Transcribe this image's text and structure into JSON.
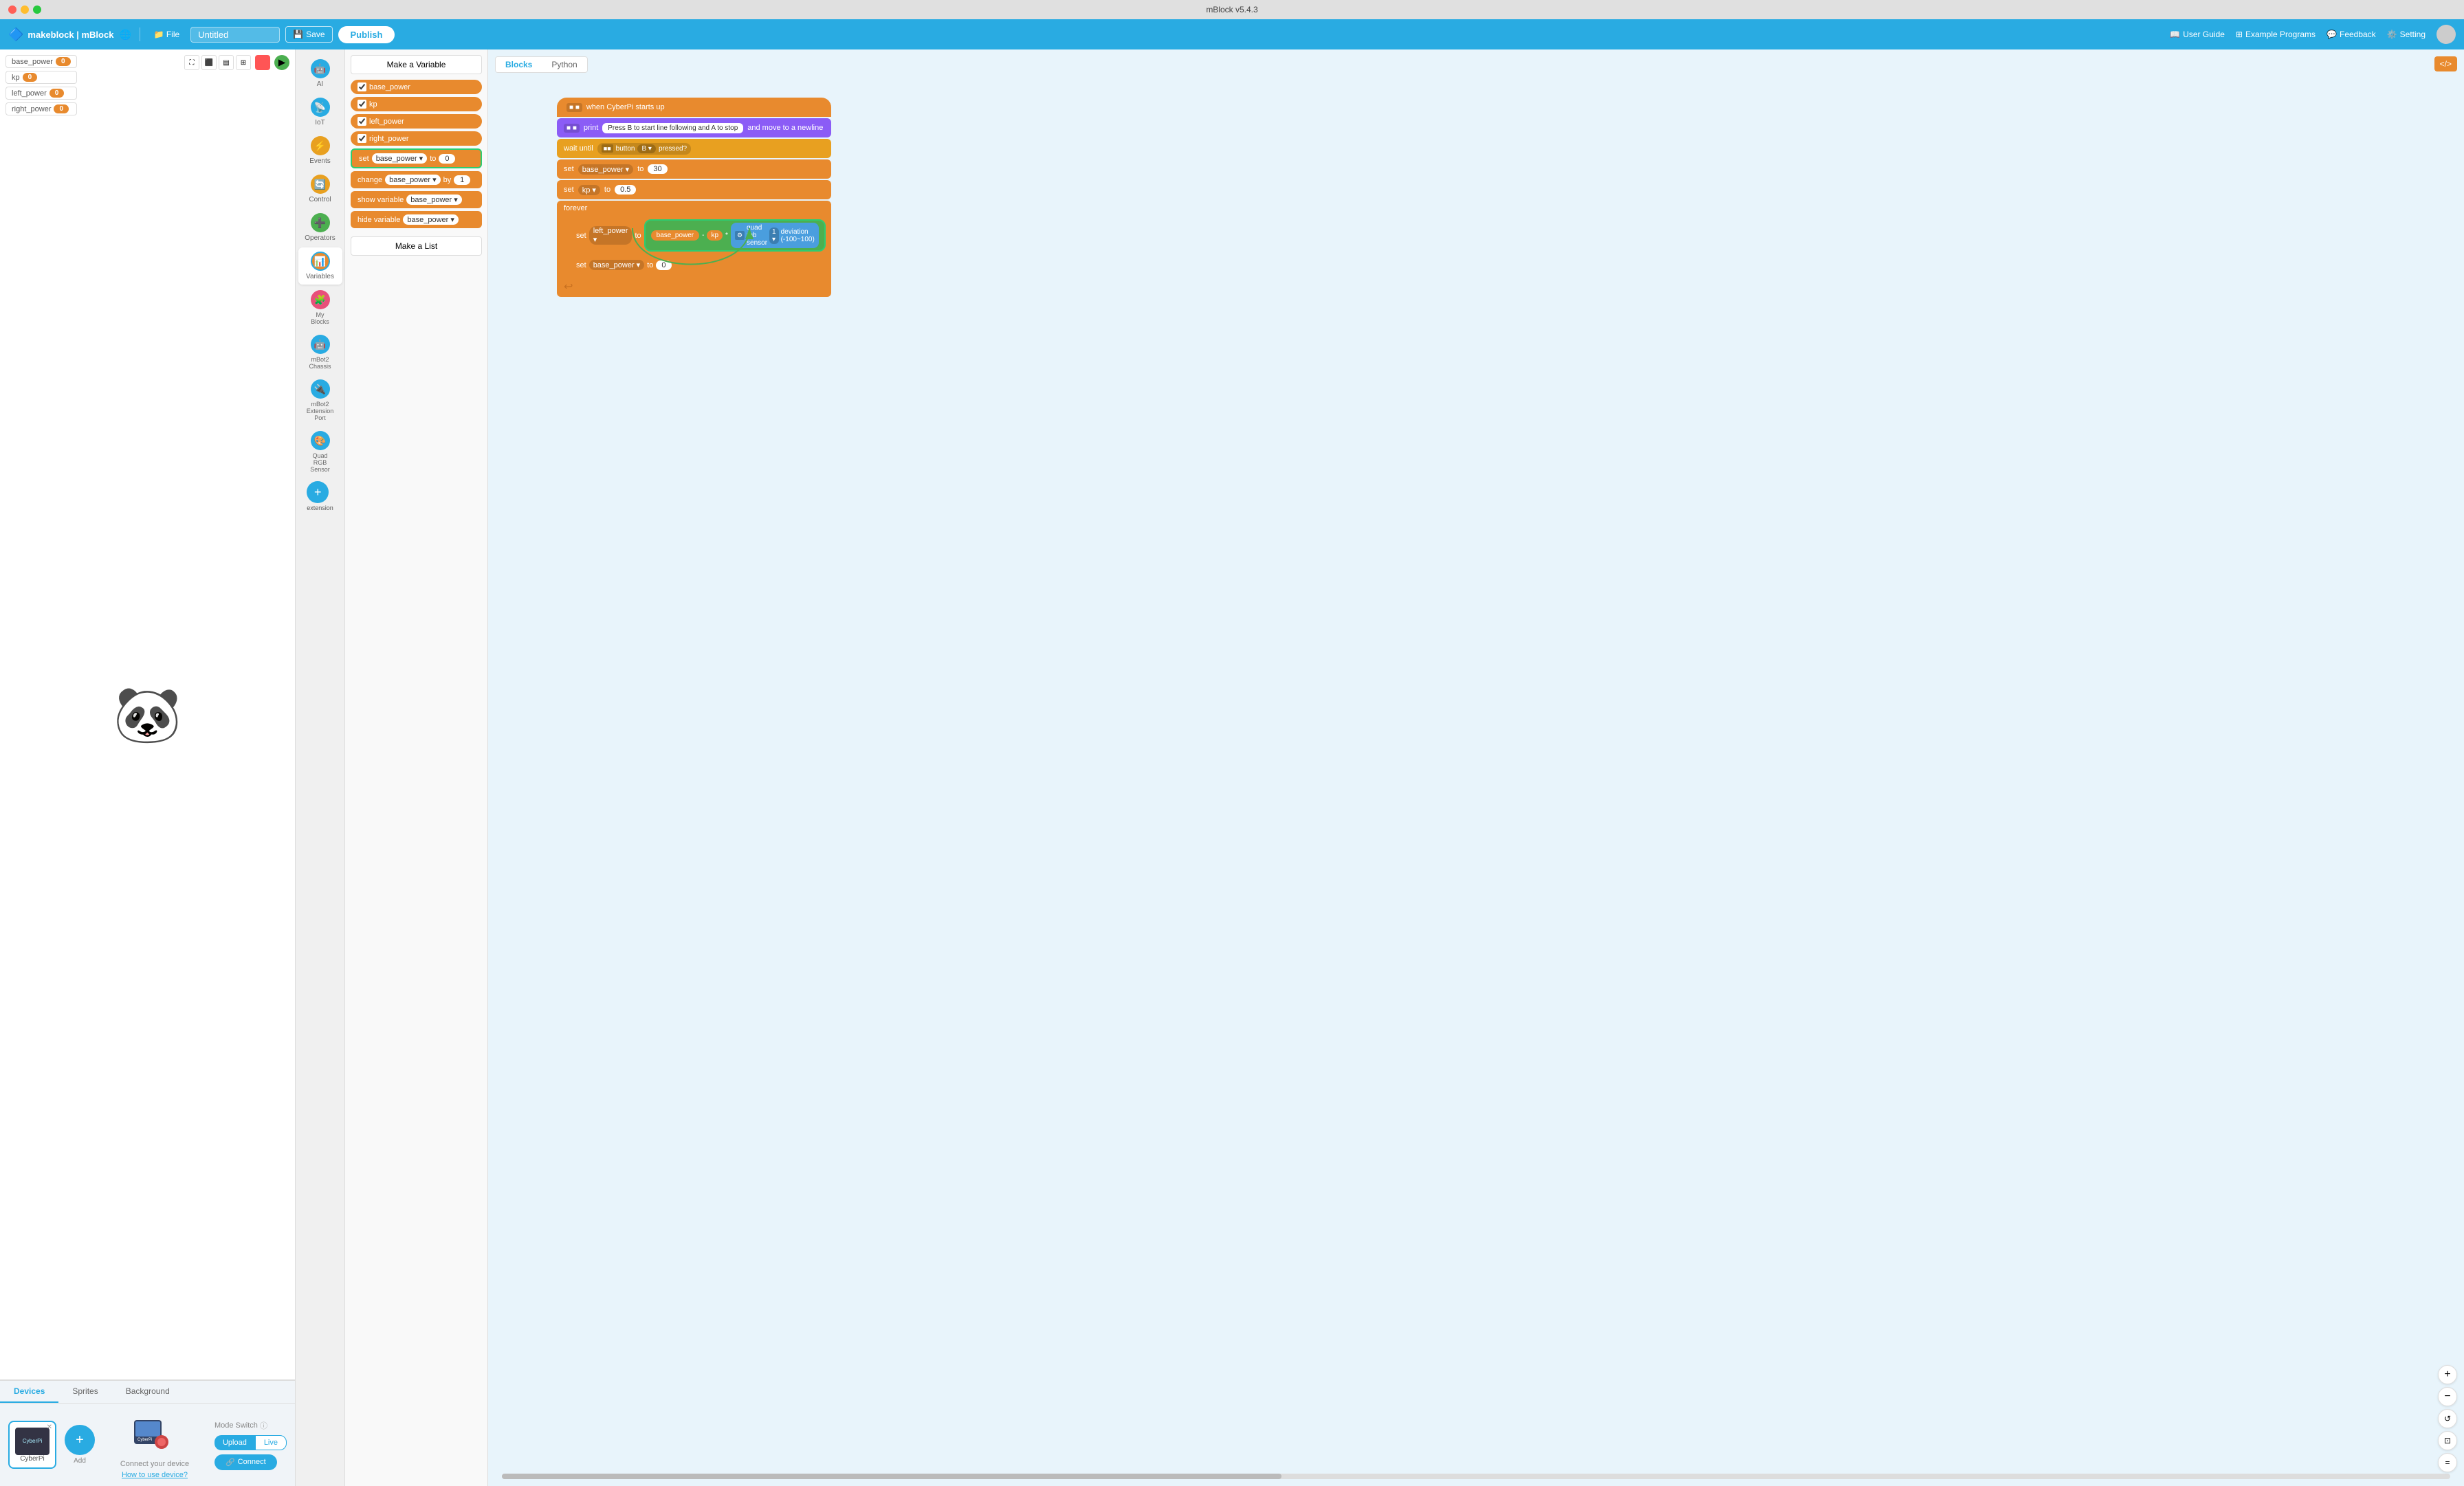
{
  "app": {
    "title": "mBlock v5.4.3",
    "logo": "makeblock | mBlock"
  },
  "header": {
    "file_label": "File",
    "project_name": "Untitled",
    "save_label": "Save",
    "publish_label": "Publish",
    "user_guide_label": "User Guide",
    "example_programs_label": "Example Programs",
    "feedback_label": "Feedback",
    "setting_label": "Setting"
  },
  "canvas_tabs": {
    "blocks_label": "Blocks",
    "python_label": "Python"
  },
  "variables": [
    {
      "name": "base_power",
      "value": "0"
    },
    {
      "name": "kp",
      "value": "0"
    },
    {
      "name": "left_power",
      "value": "0"
    },
    {
      "name": "right_power",
      "value": "0"
    }
  ],
  "stage": {
    "sprite": "🐼"
  },
  "bottom_tabs": [
    {
      "id": "devices",
      "label": "Devices",
      "active": true
    },
    {
      "id": "sprites",
      "label": "Sprites",
      "active": false
    },
    {
      "id": "background",
      "label": "Background",
      "active": false
    }
  ],
  "device": {
    "name": "CyberPi",
    "connect_text": "Connect your device",
    "how_to_use": "How to use device?",
    "mode_switch_label": "Mode Switch",
    "upload_label": "Upload",
    "live_label": "Live",
    "connect_button": "Connect"
  },
  "categories": [
    {
      "id": "ai",
      "label": "AI",
      "color": "#29abe2"
    },
    {
      "id": "iot",
      "label": "IoT",
      "color": "#29abe2"
    },
    {
      "id": "events",
      "label": "Events",
      "color": "#e8a020"
    },
    {
      "id": "control",
      "label": "Control",
      "color": "#e8a020"
    },
    {
      "id": "operators",
      "label": "Operators",
      "color": "#4caf50"
    },
    {
      "id": "variables",
      "label": "Variables",
      "color": "#e88a2e",
      "active": true
    },
    {
      "id": "myblocks",
      "label": "My Blocks",
      "color": "#e8507a"
    },
    {
      "id": "mbot2chassis",
      "label": "mBot2 Chassis",
      "color": "#29abe2"
    },
    {
      "id": "mbot2ext",
      "label": "mBot2 Extension Port",
      "color": "#29abe2"
    },
    {
      "id": "quadrgb",
      "label": "Quad RGB Sensor",
      "color": "#29abe2"
    },
    {
      "id": "extension",
      "label": "extension",
      "color": "#29abe2"
    }
  ],
  "block_panel": {
    "make_variable_btn": "Make a Variable",
    "make_list_btn": "Make a List",
    "blocks": [
      {
        "type": "variable",
        "name": "base_power",
        "checked": true
      },
      {
        "type": "variable",
        "name": "kp",
        "checked": true
      },
      {
        "type": "variable",
        "name": "left_power",
        "checked": true
      },
      {
        "type": "variable",
        "name": "right_power",
        "checked": true
      },
      {
        "type": "set",
        "var": "base_power",
        "value": "0",
        "highlighted": true
      },
      {
        "type": "change",
        "var": "base_power",
        "by": "1"
      },
      {
        "type": "show",
        "var": "base_power"
      },
      {
        "type": "hide",
        "var": "base_power"
      }
    ]
  },
  "code_blocks": {
    "when_cyberpi_starts": "when CyberPi starts up",
    "print_text": "Press B to start line following and A to stop",
    "print_suffix": "and move to a newline",
    "wait_until": "wait until",
    "button_b": "button B",
    "pressed": "pressed?",
    "set_base_power": "set",
    "set_base_power_val": "30",
    "set_kp": "set",
    "kp_val": "0.5",
    "forever": "forever",
    "set_left_power": "set",
    "left_power_label": "left_power",
    "to_label": "to",
    "base_power_ref": "base_power",
    "minus": "-",
    "kp_ref": "kp",
    "multiply": "*",
    "sensor_label": "quad rgb sensor",
    "sensor_num": "1",
    "deviation_label": "deviation (-100~100)",
    "set_base_power2": "set",
    "base_power_label2": "base_power",
    "to_zero": "0"
  },
  "zoom": {
    "zoom_in": "+",
    "zoom_out": "-",
    "reset": "↺",
    "fit": "⊡",
    "equal": "="
  }
}
